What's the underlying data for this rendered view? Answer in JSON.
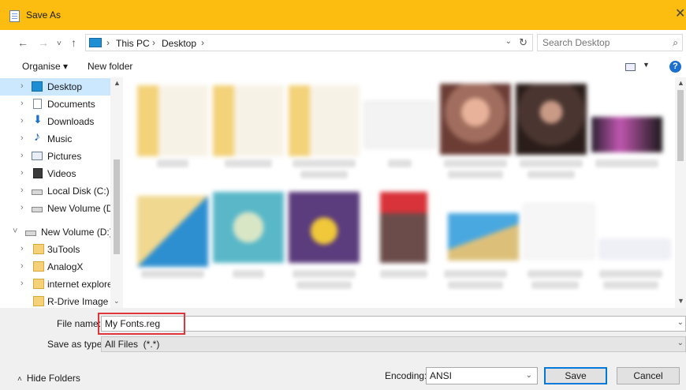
{
  "window": {
    "title": "Save As",
    "close_glyph": "✕"
  },
  "nav": {
    "back_glyph": "←",
    "forward_glyph": "→",
    "dropdown_glyph": "˅",
    "up_glyph": "↑"
  },
  "address": {
    "crumbs": [
      "This PC",
      "Desktop"
    ],
    "separator": "›",
    "dropdown_glyph": "⌄",
    "refresh_glyph": "↻"
  },
  "search": {
    "placeholder": "Search Desktop",
    "icon_glyph": "⌕"
  },
  "toolbar": {
    "organise_label": "Organise ▾",
    "new_folder_label": "New folder",
    "view_dropdown_glyph": "▼",
    "help_glyph": "?"
  },
  "sidebar": {
    "items": [
      {
        "label": "Desktop",
        "icon": "desktop-icon",
        "chevron": "›"
      },
      {
        "label": "Documents",
        "icon": "documents-icon",
        "chevron": "›"
      },
      {
        "label": "Downloads",
        "icon": "downloads-icon",
        "chevron": "›"
      },
      {
        "label": "Music",
        "icon": "music-icon",
        "chevron": "›"
      },
      {
        "label": "Pictures",
        "icon": "pictures-icon",
        "chevron": "›"
      },
      {
        "label": "Videos",
        "icon": "videos-icon",
        "chevron": "›"
      },
      {
        "label": "Local Disk (C:)",
        "icon": "drive-icon",
        "chevron": "›"
      },
      {
        "label": "New Volume (D:",
        "icon": "drive-icon",
        "chevron": "›"
      },
      {
        "label": "New Volume (D:)",
        "icon": "drive-icon",
        "chevron": "˅"
      },
      {
        "label": "3uTools",
        "icon": "folder-icon",
        "chevron": "›"
      },
      {
        "label": "AnalogX",
        "icon": "folder-icon",
        "chevron": "›"
      },
      {
        "label": "internet explorer",
        "icon": "folder-icon",
        "chevron": "›"
      },
      {
        "label": "R-Drive Image",
        "icon": "folder-icon",
        "chevron": ""
      }
    ]
  },
  "scroll": {
    "up_glyph": "▲",
    "down_glyph": "▼",
    "small_down_glyph": "⌄"
  },
  "form": {
    "file_name_label": "File name:",
    "file_name_value": "My Fonts.reg",
    "save_type_label": "Save as type:",
    "save_type_value": "All Files  (*.*)",
    "dropdown_glyph": "⌄"
  },
  "footer": {
    "hide_folders_label": "Hide Folders",
    "hide_folders_glyph": "˄",
    "encoding_label": "Encoding:",
    "encoding_value": "ANSI",
    "save_label": "Save",
    "cancel_label": "Cancel"
  },
  "colors": {
    "titlebar": "#fdbd10",
    "selection": "#cce8ff",
    "highlight_box": "#e0353a",
    "accent": "#0078d7"
  }
}
